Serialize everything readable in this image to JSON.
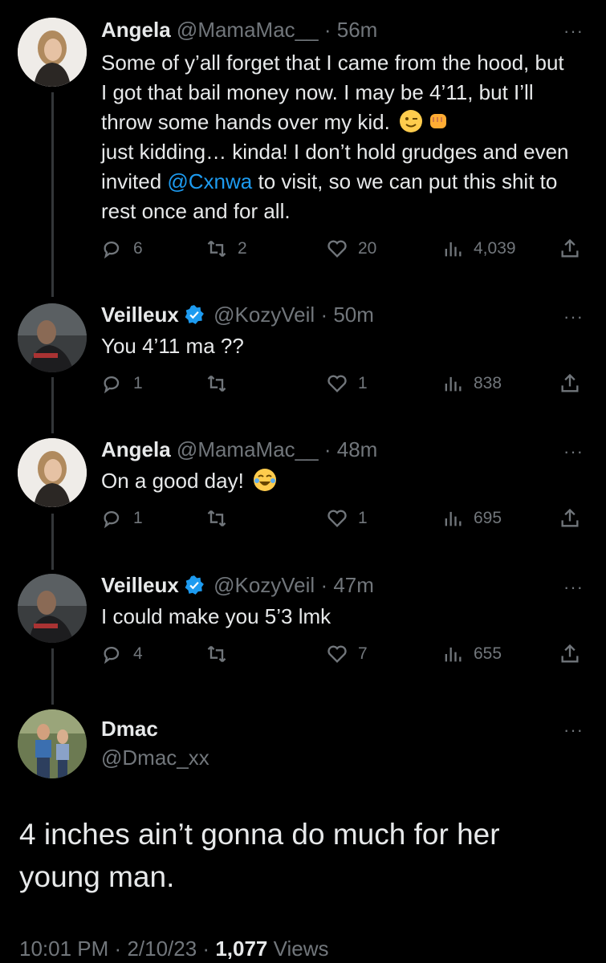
{
  "tweets": [
    {
      "name": "Angela",
      "handle": "@MamaMac__",
      "time": "56m",
      "text_before": "Some of y’all forget that I came from the hood, but I got that bail money now. I may be 4’11, but I’ll throw some hands over my kid.",
      "text_mid": "just kidding… kinda! I don’t hold grudges and even invited",
      "mention": "@Cxnwa",
      "text_after": "to visit, so we can put this shit to rest once and for all.",
      "emojis": [
        "wink-emoji",
        "fist-emoji"
      ],
      "replies": "6",
      "retweets": "2",
      "likes": "20",
      "views": "4,039"
    },
    {
      "name": "Veilleux",
      "verified": true,
      "handle": "@KozyVeil",
      "time": "50m",
      "text": "You 4’11 ma ??",
      "replies": "1",
      "retweets": "",
      "likes": "1",
      "views": "838"
    },
    {
      "name": "Angela",
      "handle": "@MamaMac__",
      "time": "48m",
      "text": "On a good day!",
      "emojis": [
        "laughing-emoji"
      ],
      "replies": "1",
      "retweets": "",
      "likes": "1",
      "views": "695"
    },
    {
      "name": "Veilleux",
      "verified": true,
      "handle": "@KozyVeil",
      "time": "47m",
      "text": "I could make you 5’3 lmk",
      "replies": "4",
      "retweets": "",
      "likes": "7",
      "views": "655"
    }
  ],
  "main_tweet": {
    "name": "Dmac",
    "handle": "@Dmac_xx",
    "text": "4 inches ain’t gonna do much for her young man.",
    "time": "10:01 PM",
    "date": "2/10/23",
    "views_count": "1,077",
    "views_label": "Views"
  },
  "separator": "·",
  "more": "···",
  "colors": {
    "background": "#000000",
    "text": "#e7e9ea",
    "muted": "#71767b",
    "link": "#1d9bf0",
    "verified": "#1d9bf0"
  }
}
